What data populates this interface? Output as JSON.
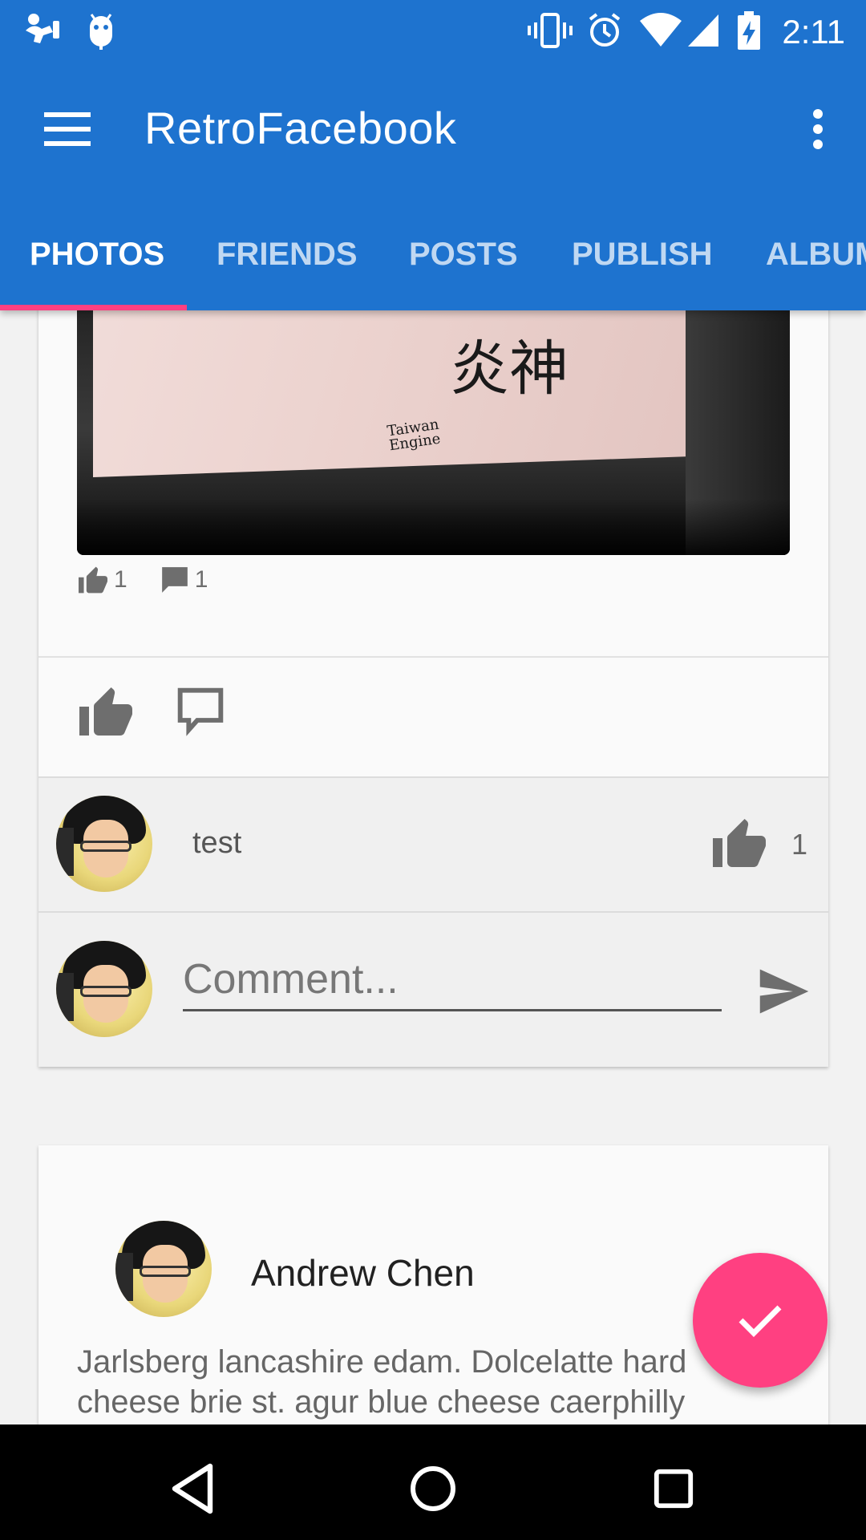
{
  "status_bar": {
    "time": "2:11",
    "icons": [
      "notification-icon",
      "android-debug-icon",
      "vibrate-icon",
      "alarm-icon",
      "wifi-icon",
      "cell-signal-icon",
      "battery-charging-icon"
    ]
  },
  "app_bar": {
    "title": "RetroFacebook",
    "menu_icon": "hamburger-menu-icon",
    "overflow_icon": "more-vert-icon"
  },
  "tabs": [
    {
      "label": "PHOTOS",
      "active": true
    },
    {
      "label": "FRIENDS",
      "active": false
    },
    {
      "label": "POSTS",
      "active": false
    },
    {
      "label": "PUBLISH",
      "active": false
    },
    {
      "label": "ALBUMS",
      "active": false
    }
  ],
  "photo_post": {
    "photo_text": "炎神",
    "photo_subtext": "Taiwan\nEngine",
    "like_count": "1",
    "comment_count": "1",
    "comments": [
      {
        "text": "test",
        "like_count": "1"
      }
    ],
    "compose": {
      "placeholder": "Comment..."
    }
  },
  "text_post": {
    "author": "Andrew Chen",
    "body": "Jarlsberg lancashire edam. Dolcelatte hard cheese brie st. agur blue cheese caerphilly"
  },
  "colors": {
    "primary": "#1e73cf",
    "accent": "#ff4081",
    "background": "#f2f2f2"
  }
}
